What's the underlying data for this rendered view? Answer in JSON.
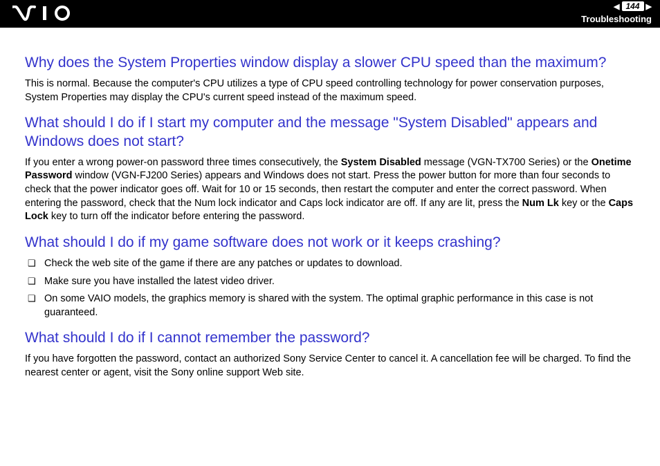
{
  "header": {
    "page_number": "144",
    "section": "Troubleshooting"
  },
  "q1": {
    "title": "Why does the System Properties window display a slower CPU speed than the maximum?",
    "body": "This is normal. Because the computer's CPU utilizes a type of CPU speed controlling technology for power conservation purposes, System Properties may display the CPU's current speed instead of the maximum speed."
  },
  "q2": {
    "title": "What should I do if I start my computer and the message \"System Disabled\" appears and Windows does not start?",
    "body_pre1": "If you enter a wrong power-on password three times consecutively, the ",
    "bold1": "System Disabled",
    "body_mid1": " message (VGN-TX700 Series) or the ",
    "bold2": "Onetime Password",
    "body_mid2": " window (VGN-FJ200 Series) appears and Windows does not start. Press the power button for more than four seconds to check that the power indicator goes off. Wait for 10 or 15 seconds, then restart the computer and enter the correct password. When entering the password, check that the Num lock indicator and Caps lock indicator are off. If any are lit, press the ",
    "bold3": "Num Lk",
    "body_mid3": " key or the ",
    "bold4": "Caps Lock",
    "body_post": " key to turn off the indicator before entering the password."
  },
  "q3": {
    "title": "What should I do if my game software does not work or it keeps crashing?",
    "items": [
      "Check the web site of the game if there are any patches or updates to download.",
      "Make sure you have installed the latest video driver.",
      "On some VAIO models, the graphics memory is shared with the system. The optimal graphic performance in this case is not guaranteed."
    ]
  },
  "q4": {
    "title": "What should I do if I cannot remember the password?",
    "body": "If you have forgotten the password, contact an authorized Sony Service Center to cancel it. A cancellation fee will be charged. To find the nearest center or agent, visit the Sony online support Web site."
  }
}
